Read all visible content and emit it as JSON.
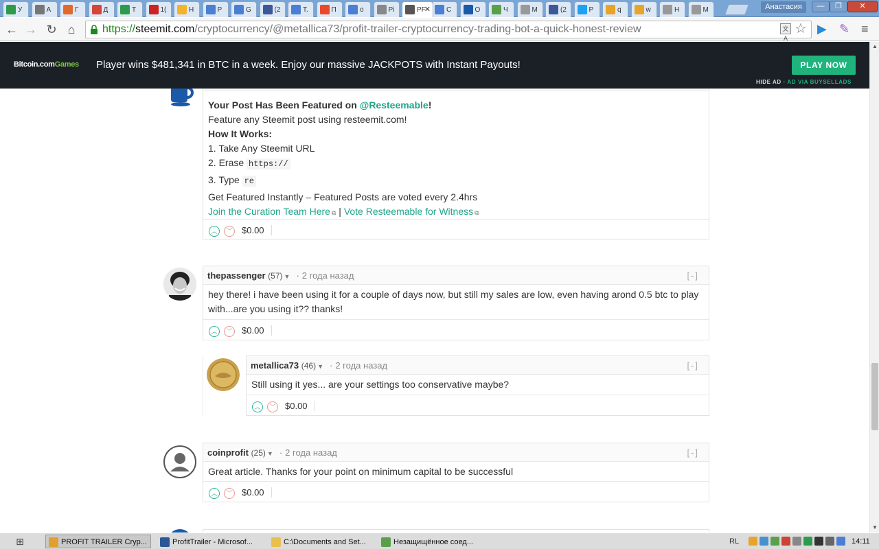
{
  "browser": {
    "tabs": [
      {
        "label": "У",
        "color": "#2e9a4b"
      },
      {
        "label": "А",
        "color": "#777777"
      },
      {
        "label": "Г",
        "color": "#e06a2c"
      },
      {
        "label": "Д",
        "color": "#d3443a"
      },
      {
        "label": "Т",
        "color": "#2e9a4b"
      },
      {
        "label": "1(",
        "color": "#cc2222"
      },
      {
        "label": "Н",
        "color": "#f2b42a"
      },
      {
        "label": "Р",
        "color": "#4a7fd4"
      },
      {
        "label": "G",
        "color": "#4a7fd4"
      },
      {
        "label": "(2",
        "color": "#3b5998"
      },
      {
        "label": "Т.",
        "color": "#4a7fd4"
      },
      {
        "label": "П",
        "color": "#e84a2a"
      },
      {
        "label": "о",
        "color": "#4a7fd4"
      },
      {
        "label": "Pi",
        "color": "#888888"
      },
      {
        "label": "PF",
        "color": "#555555",
        "active": true
      },
      {
        "label": "С",
        "color": "#4a7fd4"
      },
      {
        "label": "О",
        "color": "#1a5aa8"
      },
      {
        "label": "Ч",
        "color": "#5aa04a"
      },
      {
        "label": "М",
        "color": "#999999"
      },
      {
        "label": "(2",
        "color": "#3b5998"
      },
      {
        "label": "Р",
        "color": "#1da1f2"
      },
      {
        "label": "q",
        "color": "#e8a42a"
      },
      {
        "label": "w",
        "color": "#e8a42a"
      },
      {
        "label": "Н",
        "color": "#999999"
      },
      {
        "label": "М",
        "color": "#999999"
      }
    ],
    "active_tab_close": "✕",
    "profile_name": "Анастасия",
    "window_buttons": {
      "minimize": "—",
      "maximize": "❐",
      "close": "✕"
    },
    "nav": {
      "back": "←",
      "forward": "→",
      "reload": "↻",
      "home": "⌂"
    },
    "url": {
      "scheme": "https://",
      "host": "steemit.com",
      "path": "/cryptocurrency/@metallica73/profit-trailer-cryptocurrency-trading-bot-a-quick-honest-review"
    },
    "translate_glyph": "文A",
    "star_glyph": "☆",
    "ext1_glyph": "▶",
    "ext2_glyph": "✎",
    "menu_glyph": "≡"
  },
  "ad": {
    "logo_main": "Bitcoin.com",
    "logo_accent": "Games",
    "text": "Player wins $481,341 in BTC in a week. Enjoy our massive JACKPOTS with Instant Payouts!",
    "button": "PLAY NOW",
    "hide": "HIDE AD",
    "separator": "·",
    "via": "AD VIA BUYSELLADS"
  },
  "comments": {
    "first": {
      "collapse": "[-]",
      "title_prefix": "Your Post Has Been Featured on",
      "title_link": "@Resteemable",
      "title_suffix": "!",
      "line1": "Feature any Steemit post using resteemit.com!",
      "line2": "How It Works:",
      "step1": "1. Take Any Steemit URL",
      "step2_prefix": "2. Erase",
      "step2_code": "https://",
      "step3_prefix": "3. Type",
      "step3_code": "re",
      "line3": "Get Featured Instantly – Featured Posts are voted every 2.4hrs",
      "link1": "Join the Curation Team Here",
      "separator": "|",
      "link2": "Vote Resteemable for Witness",
      "payout": "$0.00"
    },
    "second": {
      "author": "thepassenger",
      "rep": "(57)",
      "time": "2 года назад",
      "collapse": "[-]",
      "body": "hey there! i have been using it for a couple of days now, but still my sales are low, even having arond 0.5 btc to play with...are you using it?? thanks!",
      "payout": "$0.00"
    },
    "reply": {
      "author": "metallica73",
      "rep": "(46)",
      "time": "2 года назад",
      "collapse": "[-]",
      "body": "Still using it yes... are your settings too conservative maybe?",
      "payout": "$0.00"
    },
    "third": {
      "author": "coinprofit",
      "rep": "(25)",
      "time": "2 года назад",
      "collapse": "[-]",
      "body": "Great article. Thanks for your point on minimum capital to be successful",
      "payout": "$0.00"
    },
    "dot": "·",
    "caret": "▼",
    "vote_up_glyph": "︿",
    "vote_down_glyph": "﹀",
    "ext_glyph": "⧉"
  },
  "taskbar": {
    "start_glyph": "⊞",
    "tasks": [
      {
        "label": "PROFIT TRAILER Cryp...",
        "color": "#e0a030",
        "active": true
      },
      {
        "label": "ProfitTrailer - Microsof...",
        "color": "#2b5797"
      },
      {
        "label": "C:\\Documents and Set...",
        "color": "#e8c050"
      },
      {
        "label": "Незащищённое соед...",
        "color": "#5aa04a"
      }
    ],
    "lang": "RL",
    "clock": "14:11"
  }
}
